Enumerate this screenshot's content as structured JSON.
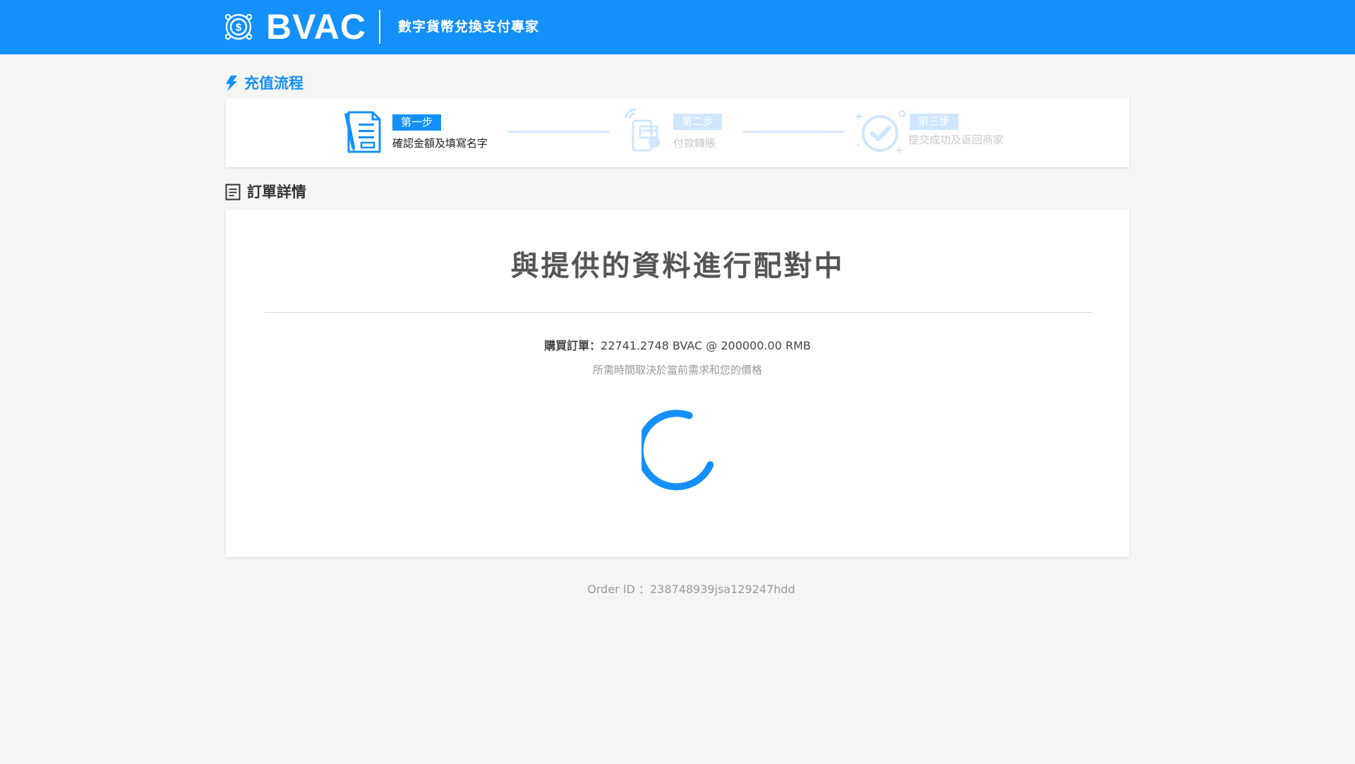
{
  "header": {
    "brand_name": "BVAC",
    "slogan": "數字貨幣兌換支付專家",
    "bg_color": "#1490fb"
  },
  "flow_section": {
    "title": "充值流程",
    "icon": "lightning-icon"
  },
  "steps": [
    {
      "badge": "第一步",
      "label": "確認金額及填寫名字",
      "icon": "form-document-icon",
      "state": "active"
    },
    {
      "badge": "第二步",
      "label": "付款轉賬",
      "icon": "mobile-payment-icon",
      "state": "inactive"
    },
    {
      "badge": "第三步",
      "label": "提交成功及返回商家",
      "icon": "check-circle-icon",
      "state": "inactive"
    }
  ],
  "order_section": {
    "title": "訂單詳情",
    "icon": "document-list-icon"
  },
  "order_card": {
    "status_title": "與提供的資料進行配對中",
    "order_label": "購買訂單：",
    "order_value": "22741.2748 BVAC @ 200000.00 RMB",
    "note": "所需時間取決於當前需求和您的價格",
    "spinner": "loading-spinner-icon"
  },
  "footer": {
    "order_id_label": "Order ID ：",
    "order_id_value": "238748939jsa129247hdd"
  },
  "colors": {
    "accent": "#1490fb",
    "inactive": "#cfe6fd",
    "background": "#f5f5f4"
  }
}
